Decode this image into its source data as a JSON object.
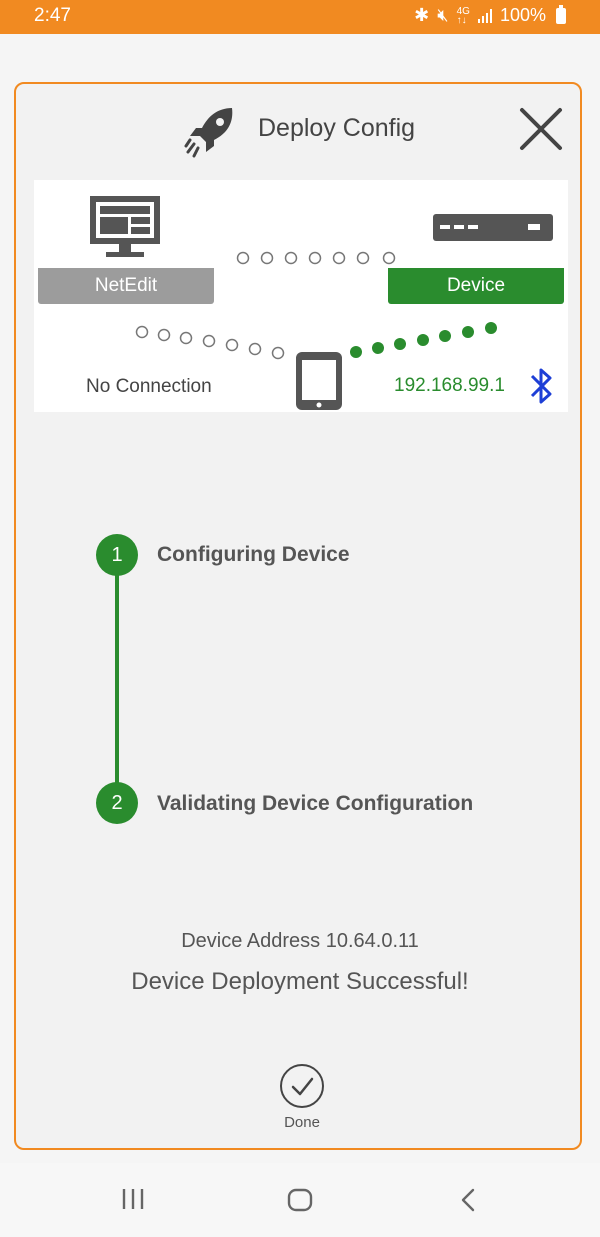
{
  "status_bar": {
    "time": "2:47",
    "battery": "100%"
  },
  "dialog": {
    "title": "Deploy Config",
    "diagram": {
      "netedit_label": "NetEdit",
      "device_label": "Device",
      "phone_status_left": "No Connection",
      "phone_status_right": "192.168.99.1"
    },
    "steps": [
      {
        "number": "1",
        "label": "Configuring Device"
      },
      {
        "number": "2",
        "label": "Validating Device Configuration"
      }
    ],
    "device_address": "Device Address 10.64.0.11",
    "success_message": "Device Deployment Successful!",
    "done_label": "Done"
  },
  "colors": {
    "accent": "#f18a21",
    "success": "#2a8c2e",
    "neutral": "#9c9c9c",
    "bluetooth": "#1e3fd6"
  },
  "nav": [
    "recent-apps",
    "home",
    "back"
  ]
}
